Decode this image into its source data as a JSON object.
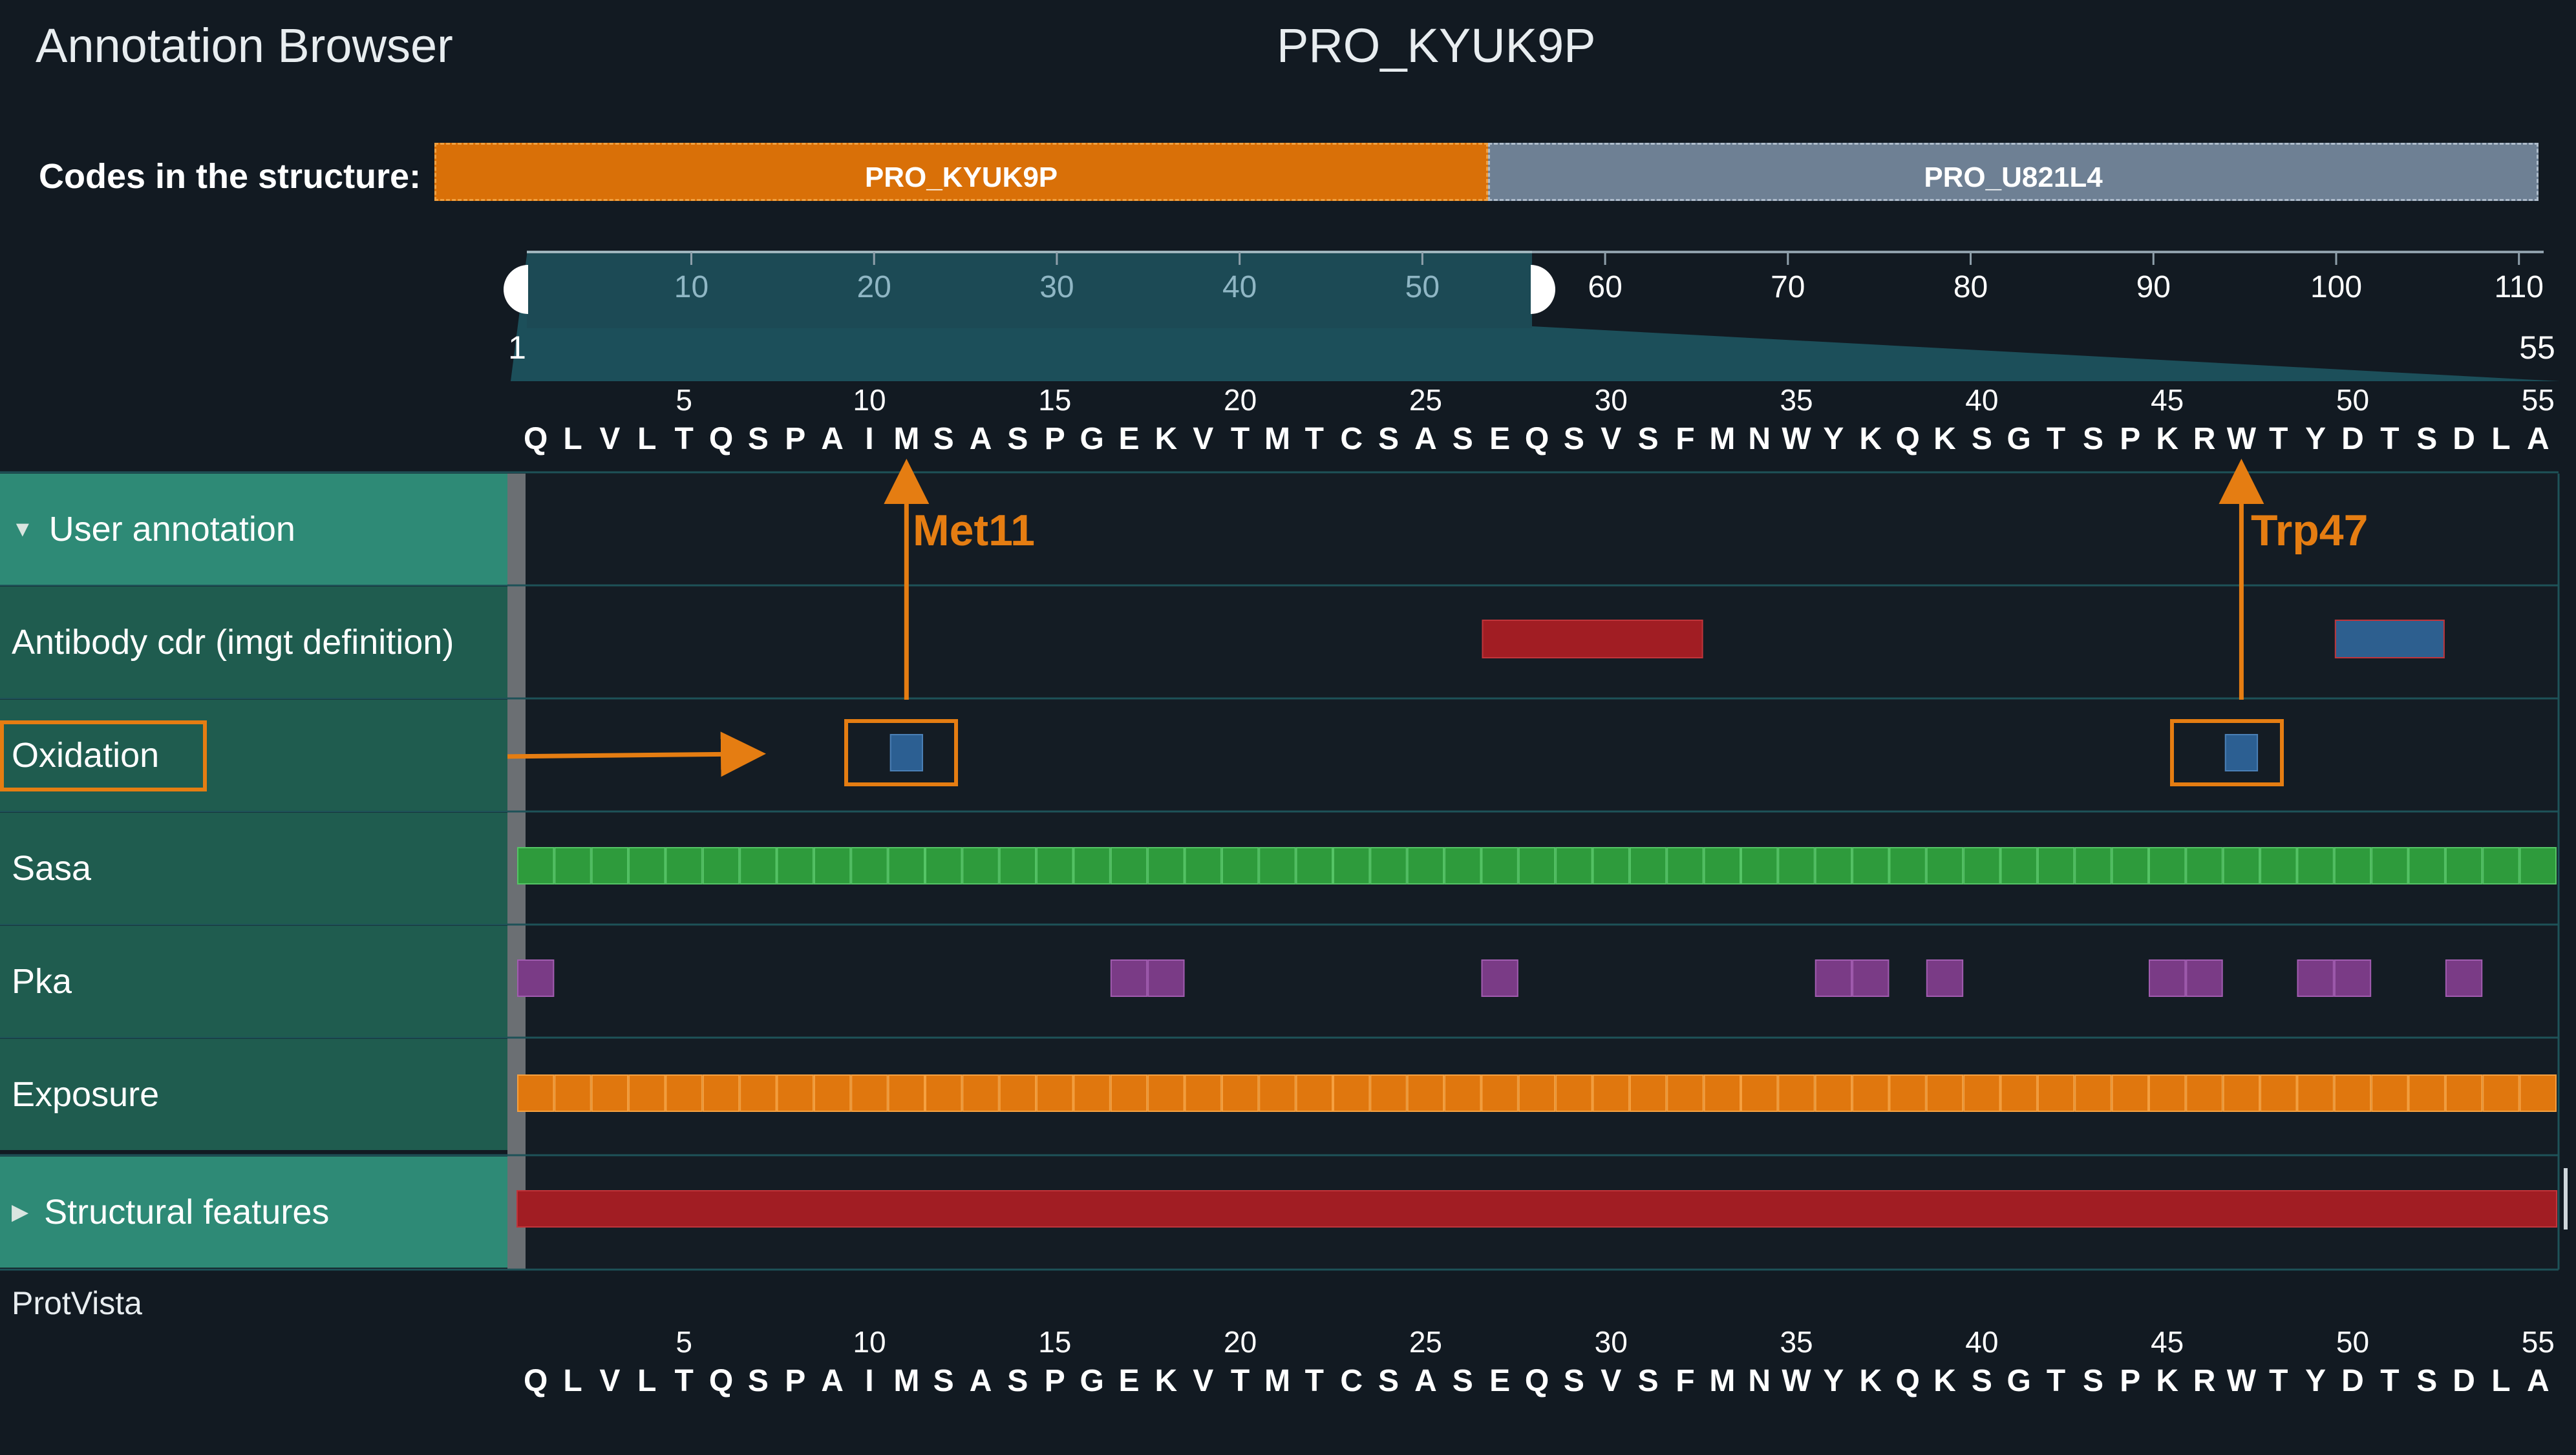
{
  "header": {
    "title": "Annotation Browser",
    "structure_name": "PRO_KYUK9P"
  },
  "codes": {
    "label": "Codes in the structure:",
    "items": [
      {
        "name": "PRO_KYUK9P",
        "color": "#d97008",
        "selected": true
      },
      {
        "name": "PRO_U821L4",
        "color": "#6e8094",
        "selected": false
      }
    ]
  },
  "ruler": {
    "ticks": [
      "10",
      "20",
      "30",
      "40",
      "50",
      "60",
      "70",
      "80",
      "90",
      "100",
      "110"
    ],
    "range_start": "1",
    "range_end": "55"
  },
  "sequence": {
    "residues": [
      "Q",
      "L",
      "V",
      "L",
      "T",
      "Q",
      "S",
      "P",
      "A",
      "I",
      "M",
      "S",
      "A",
      "S",
      "P",
      "G",
      "E",
      "K",
      "V",
      "T",
      "M",
      "T",
      "C",
      "S",
      "A",
      "S",
      "E",
      "Q",
      "S",
      "V",
      "S",
      "F",
      "M",
      "N",
      "W",
      "Y",
      "K",
      "Q",
      "K",
      "S",
      "G",
      "T",
      "S",
      "P",
      "K",
      "R",
      "W",
      "T",
      "Y",
      "D",
      "T",
      "S",
      "D",
      "L",
      "A"
    ],
    "position_labels": [
      "5",
      "10",
      "15",
      "20",
      "25",
      "30",
      "35",
      "40",
      "45",
      "50",
      "55"
    ]
  },
  "tracks": [
    {
      "label": "User annotation",
      "type": "section",
      "expanded": true
    },
    {
      "label": "Antibody cdr (imgt definition)",
      "type": "track"
    },
    {
      "label": "Oxidation",
      "type": "track",
      "highlighted": true
    },
    {
      "label": "Sasa",
      "type": "track"
    },
    {
      "label": "Pka",
      "type": "track"
    },
    {
      "label": "Exposure",
      "type": "track"
    },
    {
      "label": "Structural features",
      "type": "section",
      "expanded": false
    }
  ],
  "features": {
    "antibody_cdr": [
      {
        "start": 27,
        "end": 32,
        "color": "#a11d23"
      },
      {
        "start": 50,
        "end": 52,
        "color": "#2d5f8f"
      }
    ],
    "oxidation": [
      11,
      47
    ],
    "oxidation_color": "#2c5f92",
    "sasa_color": "#2e9b3c",
    "pka": [
      1,
      17,
      18,
      27,
      36,
      37,
      39,
      45,
      46,
      49,
      50,
      53
    ],
    "pka_color": "#7a3b86",
    "exposure_color": "#e0770e",
    "structural_color": "#a11d23"
  },
  "annotations": {
    "met_label": "Met11",
    "trp_label": "Trp47",
    "color": "#e57d12"
  },
  "footer": {
    "protvista_label": "ProtVista"
  }
}
